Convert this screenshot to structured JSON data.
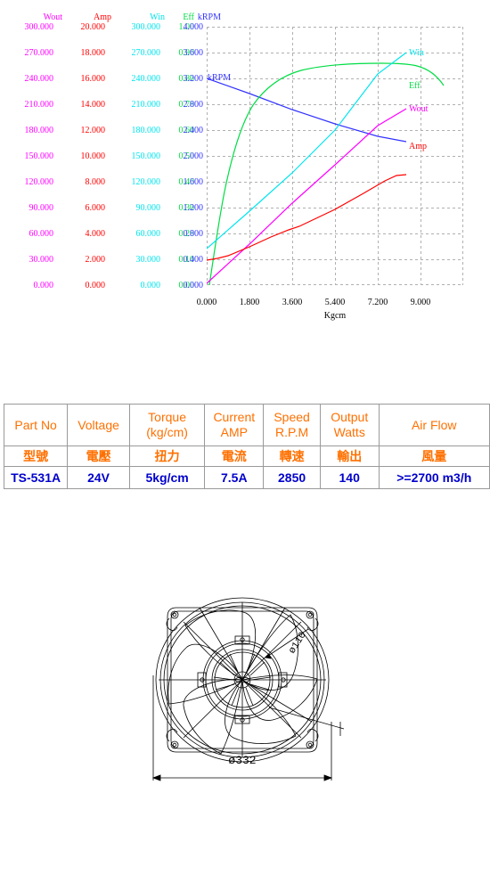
{
  "chart_data": {
    "type": "line",
    "title": "",
    "xlabel": "Kgcm",
    "xticks": [
      "0.000",
      "1.800",
      "3.600",
      "5.400",
      "7.200",
      "9.000"
    ],
    "xlim": [
      0,
      9
    ],
    "grid": true,
    "legend_position": "right-inline",
    "axes": [
      {
        "name": "Wout",
        "color": "#ff00ff",
        "ticks": [
          "300.000",
          "270.000",
          "240.000",
          "210.000",
          "180.000",
          "150.000",
          "120.000",
          "90.000",
          "60.000",
          "30.000",
          "0.000"
        ],
        "range": [
          0,
          300
        ]
      },
      {
        "name": "Amp",
        "color": "#ff0000",
        "ticks": [
          "20.000",
          "18.000",
          "16.000",
          "14.000",
          "12.000",
          "10.000",
          "8.000",
          "6.000",
          "4.000",
          "2.000",
          "0.000"
        ],
        "range": [
          0,
          20
        ]
      },
      {
        "name": "Win",
        "color": "#00e5ee",
        "ticks": [
          "300.000",
          "270.000",
          "240.000",
          "210.000",
          "180.000",
          "150.000",
          "120.000",
          "90.000",
          "60.000",
          "30.000",
          "0.000"
        ],
        "range": [
          0,
          300
        ]
      },
      {
        "name": "Eff",
        "color": "#00dd44",
        "ticks": [
          "1.00",
          "0.90",
          "0.80",
          "0.70",
          "0.60",
          "0.50",
          "0.40",
          "0.30",
          "0.20",
          "0.10",
          "0.00"
        ],
        "range": [
          0,
          1
        ]
      },
      {
        "name": "kRPM",
        "color": "#3333ff",
        "ticks": [
          "4.000",
          "3.600",
          "3.200",
          "2.800",
          "2.400",
          "2.000",
          "1.600",
          "1.200",
          "0.800",
          "0.400",
          "0.000"
        ],
        "range": [
          0,
          4
        ]
      }
    ],
    "series": [
      {
        "name": "kRPM",
        "color": "#3333ff",
        "label": "kRPM",
        "unit": "kRPM",
        "x": [
          0.0,
          1.8,
          3.6,
          5.4,
          7.2,
          8.4
        ],
        "y": [
          3.2,
          2.96,
          2.72,
          2.5,
          2.3,
          2.22
        ]
      },
      {
        "name": "Eff",
        "color": "#00dd44",
        "label": "Eff",
        "unit": "",
        "x": [
          0.1,
          0.3,
          0.6,
          1.0,
          1.5,
          2.1,
          2.7,
          3.4,
          4.2,
          5.4,
          6.6,
          7.5,
          8.4
        ],
        "y": [
          0.0,
          0.16,
          0.36,
          0.52,
          0.63,
          0.71,
          0.75,
          0.78,
          0.79,
          0.8,
          0.8,
          0.8,
          0.72
        ]
      },
      {
        "name": "Win",
        "color": "#00e5ee",
        "label": "Win",
        "unit": "W",
        "x": [
          0.0,
          1.8,
          3.6,
          5.4,
          7.2,
          8.4
        ],
        "y": [
          42,
          86,
          130,
          180,
          245,
          270
        ]
      },
      {
        "name": "Wout",
        "color": "#ff00ff",
        "label": "Wout",
        "unit": "W",
        "x": [
          0.0,
          1.8,
          3.6,
          5.4,
          7.2,
          8.4
        ],
        "y": [
          2,
          48,
          95,
          140,
          185,
          205
        ]
      },
      {
        "name": "Amp",
        "color": "#ff0000",
        "label": "Amp",
        "unit": "A",
        "x": [
          0.0,
          0.45,
          0.9,
          1.8,
          2.7,
          3.45,
          3.9,
          5.4,
          6.6,
          7.5,
          8.0,
          8.4
        ],
        "y": [
          1.9,
          2.05,
          2.25,
          2.95,
          3.7,
          4.3,
          4.55,
          5.9,
          7.1,
          8.1,
          8.5,
          8.55
        ]
      }
    ]
  },
  "spec_table": {
    "headers_en": [
      "Part No",
      "Voltage",
      "Torque\n(kg/cm)",
      "Current\nAMP",
      "Speed\nR.P.M",
      "Output\nWatts",
      "Air  Flow"
    ],
    "headers_en_line1": [
      "Part No",
      "Voltage",
      "Torque",
      "Current",
      "Speed",
      "Output",
      "Air  Flow"
    ],
    "headers_en_line2": [
      "",
      "",
      "(kg/cm)",
      "AMP",
      "R.P.M",
      "Watts",
      ""
    ],
    "headers_cn": [
      "型號",
      "電壓",
      "扭力",
      "電流",
      "轉速",
      "輸出",
      "風量"
    ],
    "values": [
      "TS-531A",
      "24V",
      "5kg/cm",
      "7.5A",
      "2850",
      "140",
      ">=2700 m3/h"
    ],
    "header_color": "#ff7000",
    "value_color": "#0000cc"
  },
  "fan_drawing": {
    "outer_diameter_label": "ø332",
    "hub_diameter_label": "ø110"
  }
}
